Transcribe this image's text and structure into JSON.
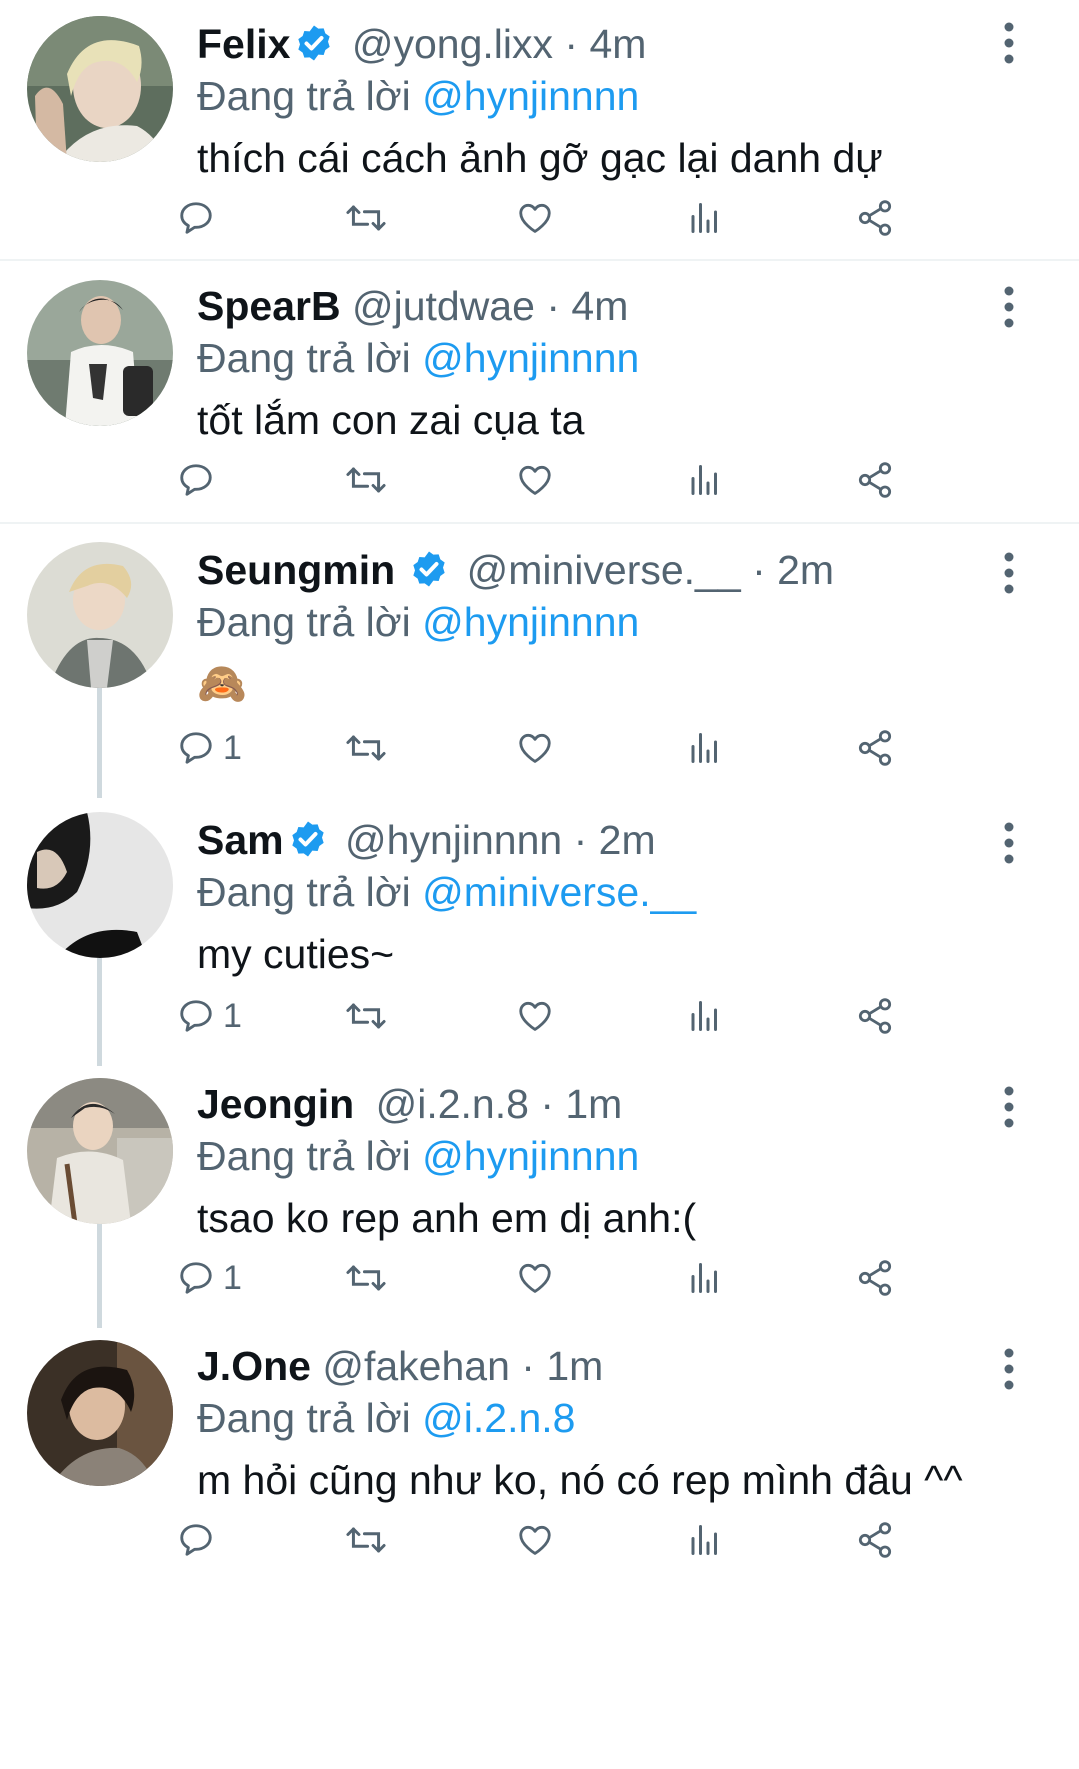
{
  "reply_prefix": "Đang trả lời",
  "colors": {
    "accent": "#1d9bf0",
    "muted": "#536471",
    "text": "#0f1419"
  },
  "icons": [
    "reply-icon",
    "retweet-icon",
    "like-icon",
    "views-icon",
    "share-icon",
    "more-icon",
    "verified-badge-icon"
  ],
  "tweets": [
    {
      "name": "Felix",
      "verified": true,
      "handle": "@yong.lixx",
      "dot": "·",
      "time": "4m",
      "reply_to": "@hynjinnnn",
      "text": "thích cái cách ảnh gỡ gạc lại danh dự",
      "reply_count": ""
    },
    {
      "name": "SpearB",
      "verified": false,
      "handle": "@jutdwae",
      "dot": "·",
      "time": "4m",
      "reply_to": "@hynjinnnn",
      "text": "tốt lắm con zai cụa ta",
      "reply_count": ""
    },
    {
      "name": "Seungmin",
      "verified": true,
      "handle": "@miniverse.__",
      "dot": "·",
      "time": "2m",
      "reply_to": "@hynjinnnn",
      "text": "🙈",
      "reply_count": "1"
    },
    {
      "name": "Sam",
      "verified": true,
      "handle": "@hynjinnnn",
      "dot": "·",
      "time": "2m",
      "reply_to": "@miniverse.__",
      "text": "my cuties~",
      "reply_count": "1"
    },
    {
      "name": "Jeongin",
      "verified": false,
      "handle": "@i.2.n.8",
      "dot": "·",
      "time": "1m",
      "reply_to": "@hynjinnnn",
      "text": "tsao ko rep anh em dị anh:(",
      "reply_count": "1"
    },
    {
      "name": "J.One",
      "verified": false,
      "handle": "@fakehan",
      "dot": "·",
      "time": "1m",
      "reply_to": "@i.2.n.8",
      "text": "m hỏi cũng như ko, nó có rep mình đâu ^^",
      "reply_count": ""
    }
  ]
}
